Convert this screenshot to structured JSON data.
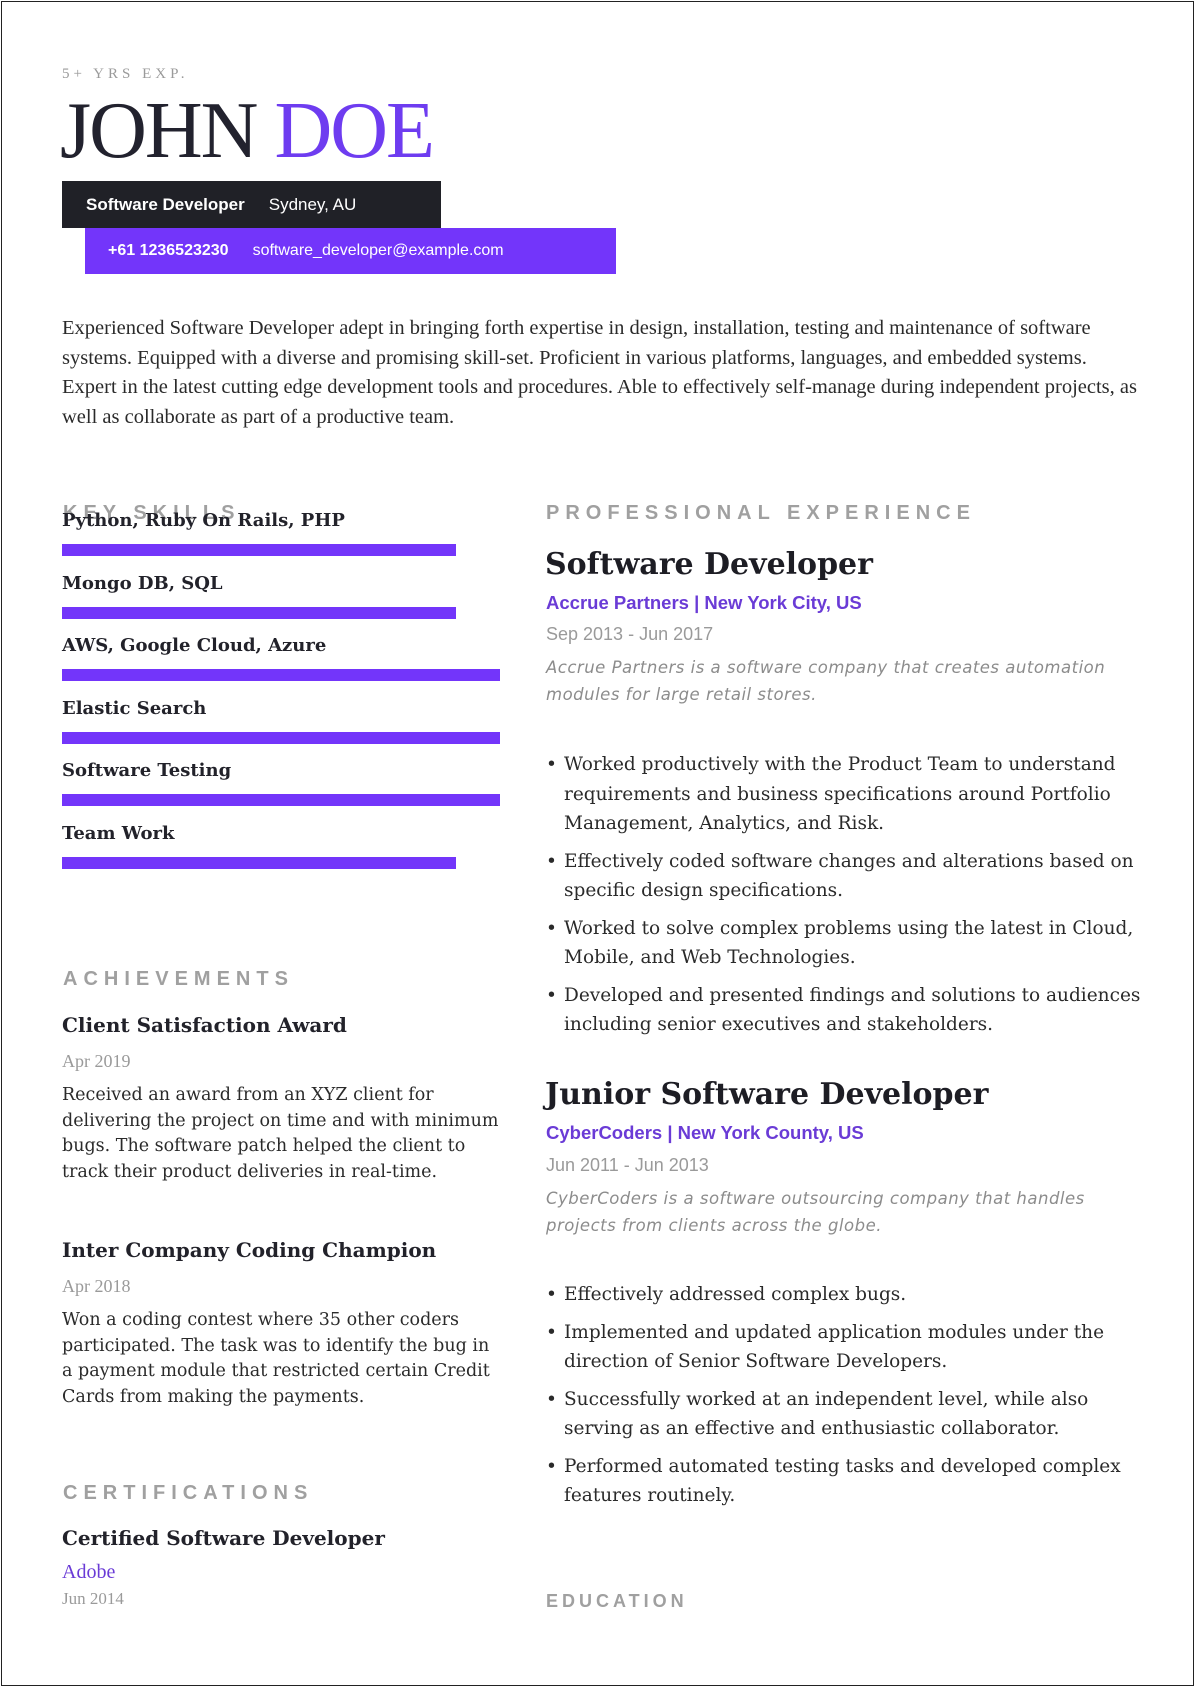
{
  "header": {
    "experience_tag": "5+ YRS EXP.",
    "first_name": "JOHN",
    "last_name": "DOE",
    "role": "Software Developer",
    "location": "Sydney, AU",
    "phone": "+61 1236523230",
    "email": "software_developer@example.com"
  },
  "summary": "Experienced Software Developer adept in bringing forth expertise in design, installation, testing and maintenance of software systems. Equipped with a diverse and promising skill-set. Proficient in various platforms, languages, and embedded systems. Expert in the latest cutting edge development tools and procedures. Able to effectively self-manage during independent projects, as well as collaborate as part of a productive team.",
  "colors": {
    "accent": "#7335fa",
    "dark": "#202127",
    "section_title": "#a0a0a0"
  },
  "skills": {
    "title": "KEY SKILLS",
    "items": [
      {
        "label": "Python, Ruby On Rails, PHP",
        "level": 0.9
      },
      {
        "label": "Mongo DB, SQL",
        "level": 0.9
      },
      {
        "label": "AWS, Google Cloud, Azure",
        "level": 1.0
      },
      {
        "label": "Elastic Search",
        "level": 1.0
      },
      {
        "label": "Software Testing",
        "level": 1.0
      },
      {
        "label": "Team Work",
        "level": 0.9
      }
    ]
  },
  "achievements": {
    "title": "ACHIEVEMENTS",
    "items": [
      {
        "title": "Client Satisfaction Award",
        "date": "Apr 2019",
        "body": "Received an award from an XYZ client for delivering the project on time and with minimum bugs. The software patch helped the client to track their product deliveries in real-time."
      },
      {
        "title": "Inter Company Coding Champion",
        "date": "Apr 2018",
        "body": "Won a coding contest where 35 other coders participated. The task was to identify the bug in a payment module that restricted certain Credit Cards from making the payments."
      }
    ]
  },
  "certifications": {
    "title": "CERTIFICATIONS",
    "items": [
      {
        "title": "Certified Software Developer",
        "issuer": "Adobe",
        "date": "Jun 2014"
      }
    ]
  },
  "experience": {
    "title": "PROFESSIONAL EXPERIENCE",
    "jobs": [
      {
        "title": "Software Developer",
        "company": "Accrue Partners | New York City, US",
        "dates": "Sep 2013 - Jun 2017",
        "description": "Accrue Partners is a software company that creates automation modules for large retail stores.",
        "bullets": [
          "Worked productively with the Product Team to understand requirements and business specifications around Portfolio Management, Analytics, and Risk.",
          "Effectively coded software changes and alterations based on specific design specifications.",
          "Worked to solve complex problems using the latest in Cloud, Mobile, and Web Technologies.",
          "Developed and presented findings and solutions to audiences including senior executives and stakeholders."
        ]
      },
      {
        "title": "Junior Software Developer",
        "company": "CyberCoders | New York County, US",
        "dates": "Jun 2011 - Jun 2013",
        "description": "CyberCoders is a software outsourcing company that handles projects from clients across the globe.",
        "bullets": [
          "Effectively addressed complex bugs.",
          "Implemented and updated application modules under the direction of Senior Software Developers.",
          "Successfully worked at an independent level, while also serving as an effective and enthusiastic collaborator.",
          "Performed automated testing tasks and developed complex features routinely."
        ]
      }
    ]
  },
  "education": {
    "title": "EDUCATION"
  }
}
